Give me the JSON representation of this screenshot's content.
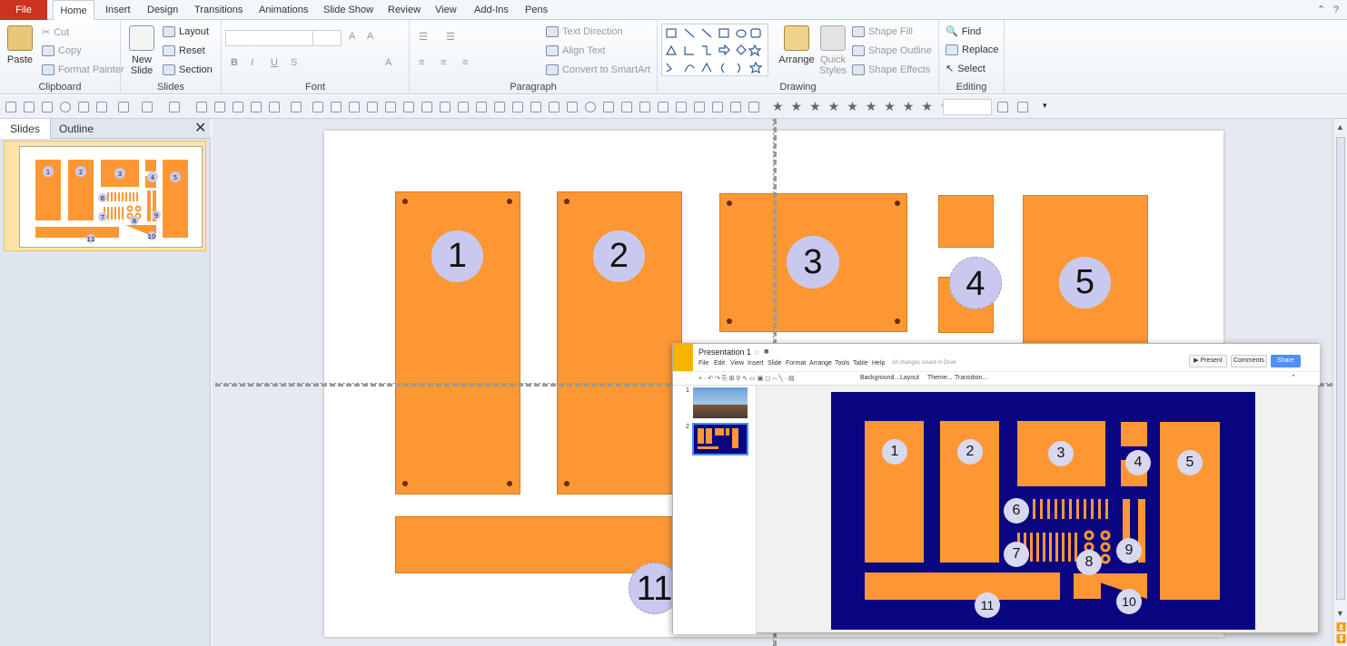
{
  "tabs": [
    "File",
    "Home",
    "Insert",
    "Design",
    "Transitions",
    "Animations",
    "Slide Show",
    "Review",
    "View",
    "Add-Ins",
    "Pens"
  ],
  "clipboard": {
    "paste": "Paste",
    "cut": "Cut",
    "copy": "Copy",
    "format_painter": "Format Painter",
    "label": "Clipboard"
  },
  "slides_grp": {
    "new_slide": "New Slide",
    "layout": "Layout",
    "reset": "Reset",
    "section": "Section",
    "label": "Slides"
  },
  "font": {
    "label": "Font"
  },
  "paragraph": {
    "text_direction": "Text Direction",
    "align_text": "Align Text",
    "smartart": "Convert to SmartArt",
    "label": "Paragraph"
  },
  "drawing": {
    "arrange": "Arrange",
    "quick_styles": "Quick Styles",
    "shape_fill": "Shape Fill",
    "shape_outline": "Shape Outline",
    "shape_effects": "Shape Effects",
    "label": "Drawing"
  },
  "editing": {
    "find": "Find",
    "replace": "Replace",
    "select": "Select",
    "label": "Editing"
  },
  "panel": {
    "slides_tab": "Slides",
    "outline_tab": "Outline",
    "slide_number": "1"
  },
  "slide_numbers": [
    "1",
    "2",
    "3",
    "4",
    "5",
    "11"
  ],
  "gslides": {
    "title": "Presentation 1",
    "menu": [
      "File",
      "Edit",
      "View",
      "Insert",
      "Slide",
      "Format",
      "Arrange",
      "Tools",
      "Table",
      "Help"
    ],
    "saved": "All changes saved in Drive",
    "present": "Present",
    "comments": "Comments",
    "share": "Share",
    "toolbar": [
      "Background...",
      "Layout",
      "Theme...",
      "Transition..."
    ],
    "thumb_nums": [
      "1",
      "2"
    ],
    "slide_numbers": [
      "1",
      "2",
      "3",
      "4",
      "5",
      "6",
      "7",
      "8",
      "9",
      "10",
      "11"
    ]
  },
  "colors": {
    "orange": "#fd9734",
    "navy": "#0a0580",
    "badge": "#c9c9ef"
  }
}
